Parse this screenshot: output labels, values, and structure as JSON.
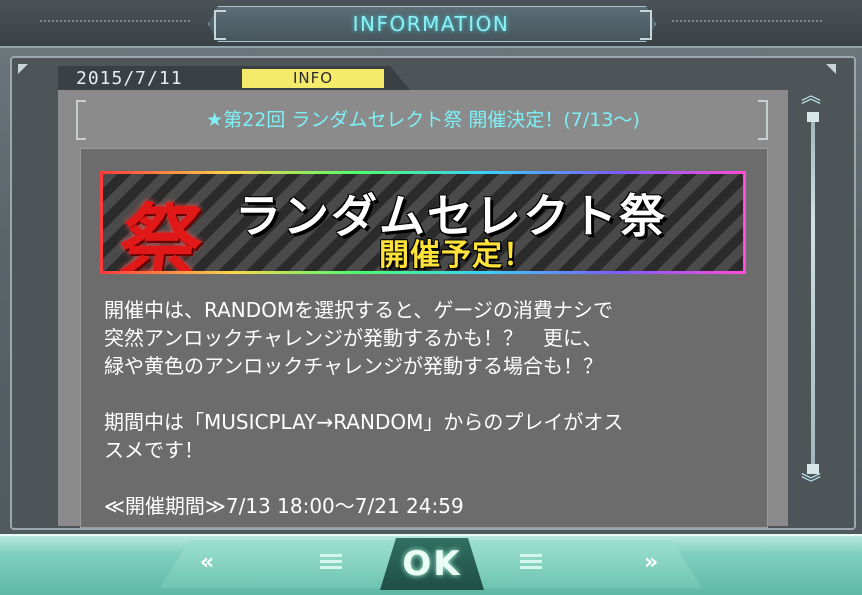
{
  "window": {
    "title": "INFORMATION"
  },
  "post": {
    "date": "2015/7/11",
    "category": "INFO",
    "headline": "★第22回 ランダムセレクト祭 開催決定！(7/13～)"
  },
  "banner": {
    "kanji": "祭",
    "title": "ランダムセレクト祭",
    "subtitle": "開催予定！"
  },
  "body": {
    "paragraph1": "開催中は、RANDOMを選択すると、ゲージの消費ナシで\n突然アンロックチャレンジが発動するかも！？　更に、\n緑や黄色のアンロックチャレンジが発動する場合も！？",
    "paragraph2": "期間中は「MUSICPLAY→RANDOM」からのプレイがオス\nスメです！",
    "period": "≪開催期間≫7/13 18:00～7/21 24:59"
  },
  "scrollbar": {
    "up_icon": "︽",
    "down_icon": "︾"
  },
  "footer": {
    "ok_label": "OK",
    "prev_label": "«",
    "next_label": "»"
  }
}
